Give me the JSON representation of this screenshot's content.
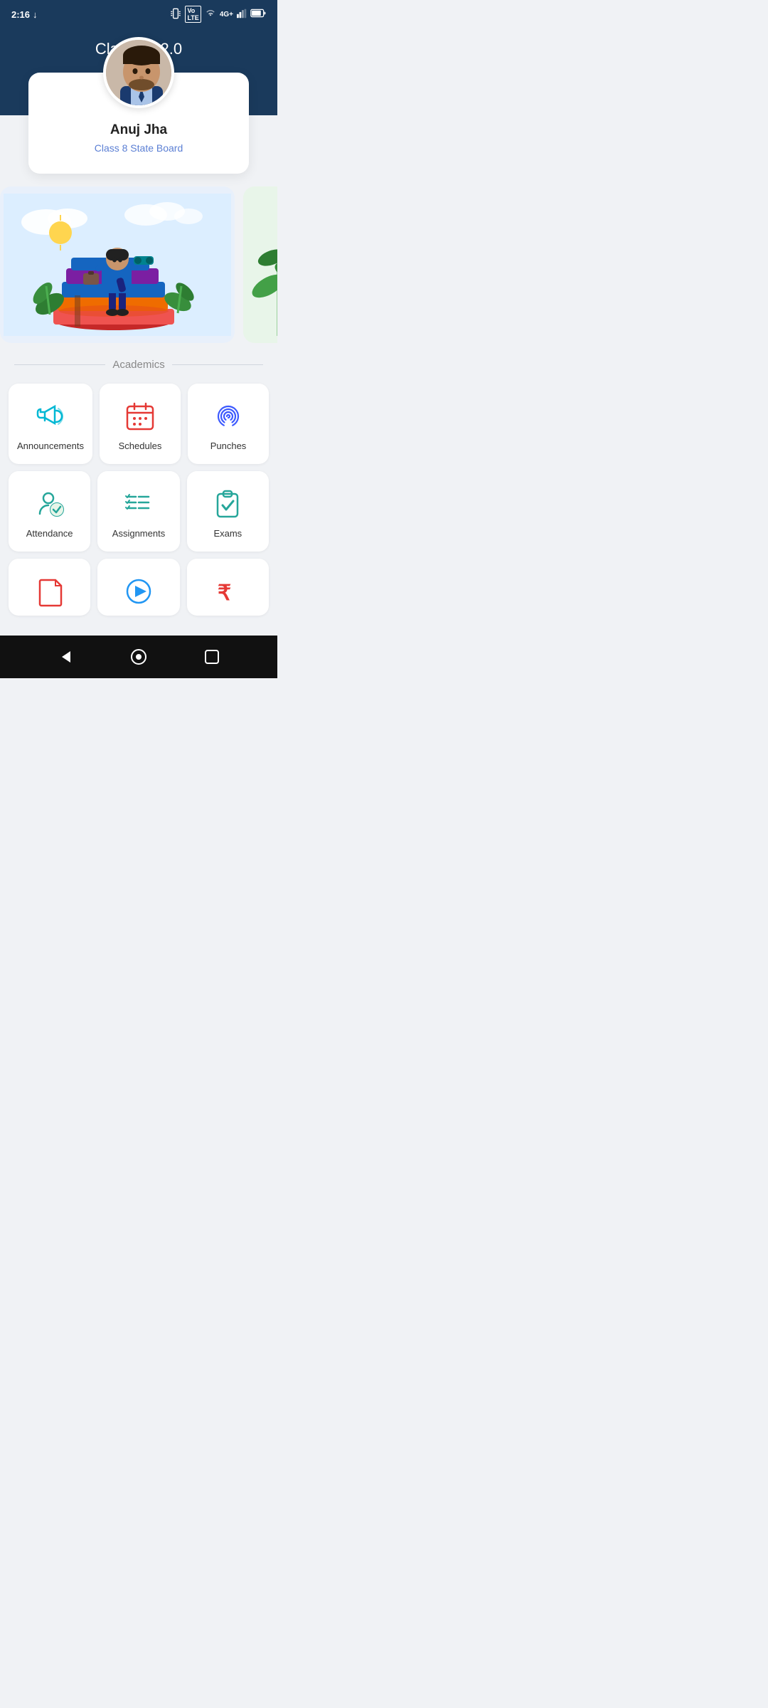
{
  "statusBar": {
    "time": "2:16",
    "downloadIcon": "↓",
    "vibrate": "📳",
    "volte": "VoLTE",
    "wifi": "wifi",
    "signal4g": "4G+",
    "battery": "battery"
  },
  "header": {
    "title": "Classbot 2.0"
  },
  "profile": {
    "name": "Anuj Jha",
    "class": "Class 8 State Board"
  },
  "sections": {
    "academics": "Academics"
  },
  "grid": {
    "row1": [
      {
        "id": "announcements",
        "label": "Announcements",
        "iconColor": "#00b8d4"
      },
      {
        "id": "schedules",
        "label": "Schedules",
        "iconColor": "#e53935"
      },
      {
        "id": "punches",
        "label": "Punches",
        "iconColor": "#3d5afe"
      }
    ],
    "row2": [
      {
        "id": "attendance",
        "label": "Attendance",
        "iconColor": "#26a69a"
      },
      {
        "id": "assignments",
        "label": "Assignments",
        "iconColor": "#26a69a"
      },
      {
        "id": "exams",
        "label": "Exams",
        "iconColor": "#26a69a"
      }
    ],
    "row3": [
      {
        "id": "notes",
        "label": "Notes",
        "iconColor": "#e53935"
      },
      {
        "id": "videos",
        "label": "Videos",
        "iconColor": "#2196f3"
      },
      {
        "id": "fees",
        "label": "Fees",
        "iconColor": "#e53935"
      }
    ]
  }
}
